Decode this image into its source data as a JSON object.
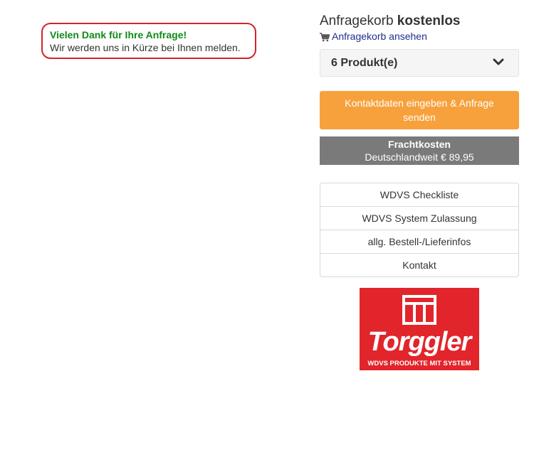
{
  "notice": {
    "title": "Vielen Dank für Ihre Anfrage!",
    "text": "Wir werden uns in Kürze bei Ihnen melden."
  },
  "basket": {
    "title_prefix": "Anfragekorb",
    "title_bold": "kostenlos",
    "view_link": "Anfragekorb ansehen",
    "product_count": "6 Produkt(e)"
  },
  "cta": {
    "label": "Kontaktdaten eingeben & Anfrage senden"
  },
  "freight": {
    "title": "Frachtkosten",
    "text": "Deutschlandweit € 89,95"
  },
  "links": [
    {
      "label": "WDVS Checkliste"
    },
    {
      "label": "WDVS System Zulassung"
    },
    {
      "label": "allg. Bestell-/Lieferinfos"
    },
    {
      "label": "Kontakt"
    }
  ],
  "logo": {
    "brand": "Torggler",
    "tagline": "WDVS PRODUKTE MIT SYSTEM"
  },
  "colors": {
    "success_green": "#0f8a17",
    "notice_border": "#d2232a",
    "cta_orange": "#f7a13c",
    "freight_gray": "#7a7a7a",
    "link_blue": "#1f2e8a",
    "logo_red": "#e1252b"
  },
  "icons": {
    "cart": "shopping-cart-icon",
    "dropdown": "chevron-down-icon"
  }
}
